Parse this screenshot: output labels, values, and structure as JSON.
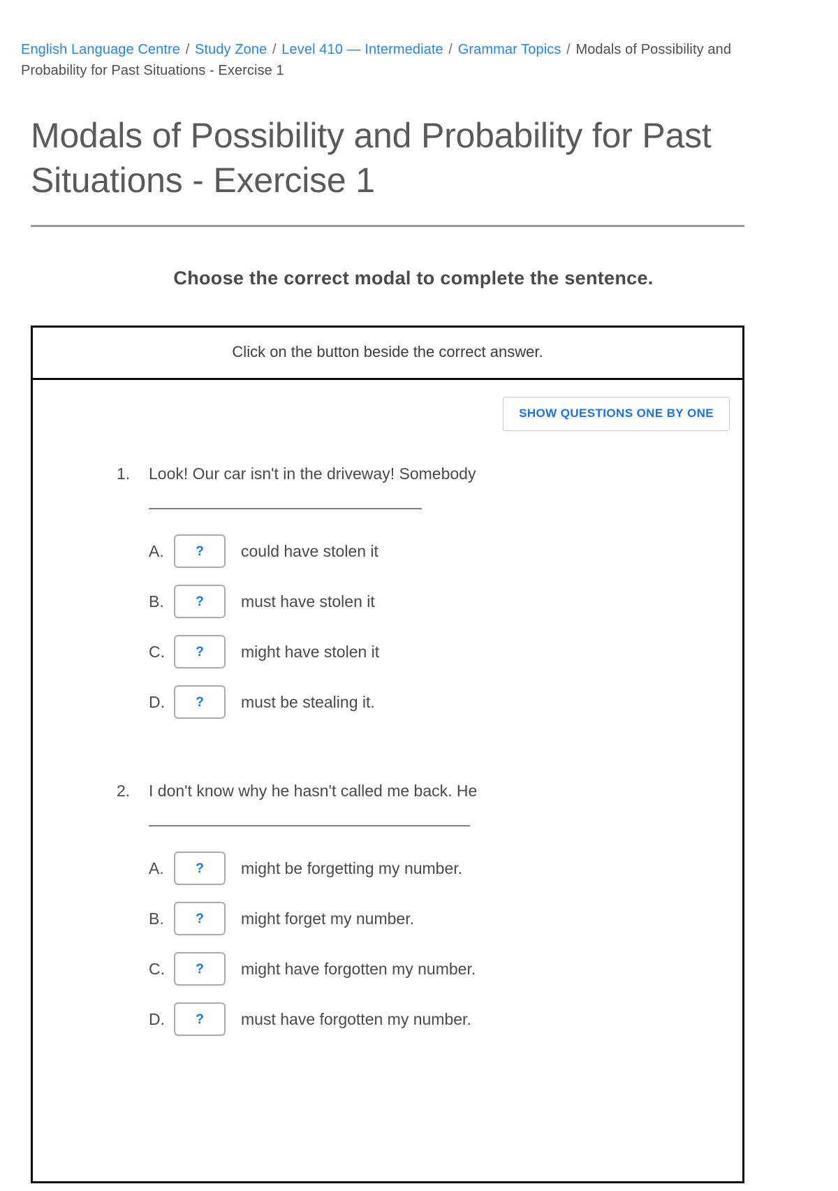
{
  "breadcrumb": {
    "items": [
      {
        "label": "English Language Centre",
        "link": true
      },
      {
        "label": "Study Zone",
        "link": true
      },
      {
        "label": "Level 410 — Intermediate",
        "link": true
      },
      {
        "label": "Grammar Topics",
        "link": true
      },
      {
        "label": "Modals of Possibility and Probability for Past Situations - Exercise 1",
        "link": false
      }
    ],
    "separator": "/"
  },
  "page_title": "Modals of Possibility and Probability for Past Situations - Exercise 1",
  "subheading": "Choose the correct modal to complete the sentence.",
  "instruction": "Click on the button beside the correct answer.",
  "toolbar": {
    "show_one_by_one_label": "SHOW QUESTIONS ONE BY ONE"
  },
  "option_button_symbol": "?",
  "colors": {
    "link": "#2b86e0",
    "accent": "#1a73e8",
    "text": "#4a4a4a",
    "border": "#0a0a0a",
    "option_border": "#adadad"
  },
  "questions": [
    {
      "number": "1.",
      "text": "Look! Our car isn't in the driveway! Somebody",
      "blank": "—————————————————",
      "options": [
        {
          "letter": "A.",
          "text": "could have stolen it"
        },
        {
          "letter": "B.",
          "text": "must have stolen it"
        },
        {
          "letter": "C.",
          "text": "might have stolen it"
        },
        {
          "letter": "D.",
          "text": "must be stealing it."
        }
      ]
    },
    {
      "number": "2.",
      "text": "I don't know why he hasn't called me back. He",
      "blank": "————————————————————",
      "options": [
        {
          "letter": "A.",
          "text": "might be forgetting my number."
        },
        {
          "letter": "B.",
          "text": "might forget my number."
        },
        {
          "letter": "C.",
          "text": "might have forgotten my number."
        },
        {
          "letter": "D.",
          "text": "must have forgotten my number."
        }
      ]
    }
  ]
}
